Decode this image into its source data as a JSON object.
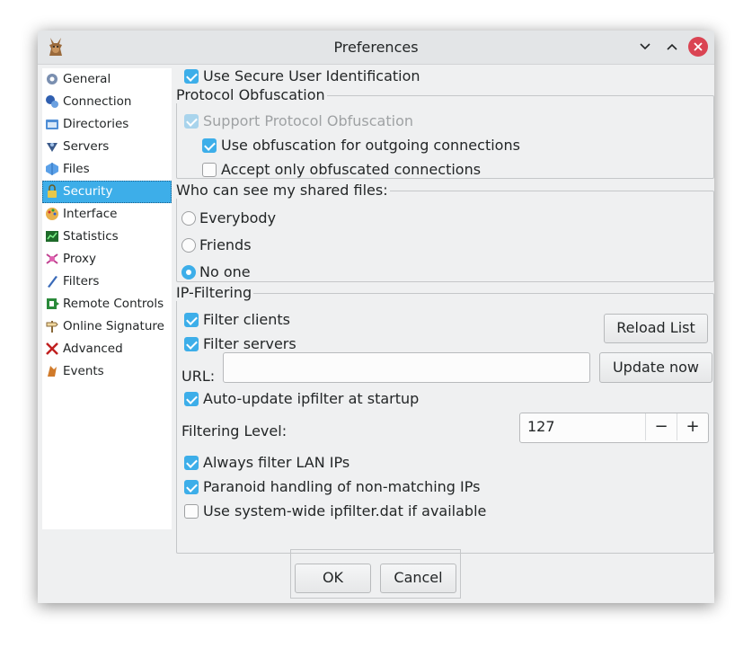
{
  "window": {
    "title": "Preferences"
  },
  "sidebar": {
    "items": [
      {
        "label": "General",
        "icon": "gear-icon"
      },
      {
        "label": "Connection",
        "icon": "connection-icon"
      },
      {
        "label": "Directories",
        "icon": "folder-icon"
      },
      {
        "label": "Servers",
        "icon": "server-icon"
      },
      {
        "label": "Files",
        "icon": "file-icon"
      },
      {
        "label": "Security",
        "icon": "lock-icon",
        "selected": true
      },
      {
        "label": "Interface",
        "icon": "palette-icon"
      },
      {
        "label": "Statistics",
        "icon": "chart-icon"
      },
      {
        "label": "Proxy",
        "icon": "proxy-icon"
      },
      {
        "label": "Filters",
        "icon": "filter-icon"
      },
      {
        "label": "Remote Controls",
        "icon": "remote-icon"
      },
      {
        "label": "Online Signature",
        "icon": "signpost-icon"
      },
      {
        "label": "Advanced",
        "icon": "tools-icon"
      },
      {
        "label": "Events",
        "icon": "events-icon"
      }
    ]
  },
  "security": {
    "secure_ident": {
      "label": "Use Secure User Identification",
      "checked": true
    },
    "obfuscation": {
      "title": "Protocol Obfuscation",
      "support": {
        "label": "Support Protocol Obfuscation",
        "checked": true,
        "disabled": true
      },
      "outgoing": {
        "label": "Use obfuscation for outgoing connections",
        "checked": true
      },
      "only": {
        "label": "Accept only obfuscated connections",
        "checked": false
      }
    },
    "shared": {
      "title": "Who can see my shared files:",
      "options": [
        "Everybody",
        "Friends",
        "No one"
      ],
      "selected": "No one"
    },
    "ipfilter": {
      "title": "IP-Filtering",
      "filter_clients": {
        "label": "Filter clients",
        "checked": true
      },
      "filter_servers": {
        "label": "Filter servers",
        "checked": true
      },
      "reload_label": "Reload List",
      "url_label": "URL:",
      "url_value": "",
      "update_label": "Update now",
      "auto_update": {
        "label": "Auto-update ipfilter at startup",
        "checked": true
      },
      "level_label": "Filtering Level:",
      "level_value": "127",
      "lan": {
        "label": "Always filter LAN IPs",
        "checked": true
      },
      "paranoid": {
        "label": "Paranoid handling of non-matching IPs",
        "checked": true
      },
      "system_wide": {
        "label": "Use system-wide ipfilter.dat if available",
        "checked": false
      }
    }
  },
  "footer": {
    "ok_label": "OK",
    "cancel_label": "Cancel"
  },
  "colors": {
    "accent": "#3daee9",
    "close": "#da4453"
  }
}
